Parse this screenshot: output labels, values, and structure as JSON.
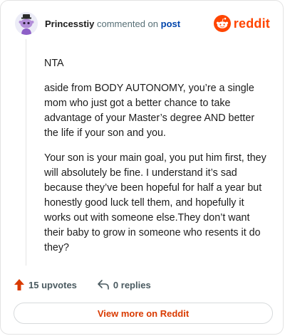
{
  "comment": {
    "username": "Princesstiy",
    "action_text": "commented on",
    "target_link": "post",
    "brand": "reddit",
    "paragraphs": [
      "NTA",
      "aside from BODY AUTONOMY, you’re a single mom who just got a better chance to take advantage of your Master’s degree AND better the life if your son and you.",
      "Your son is your main goal, you put him first, they will absolutely be fine. I understand it’s sad because they’ve been hopeful for half a year but honestly good luck tell them, and hopefully it works out with someone else.They don’t want their baby to grow in someone who resents it do they?"
    ],
    "upvotes": "15 upvotes",
    "replies": "0 replies",
    "view_more": "View more on Reddit"
  },
  "colors": {
    "brand": "#ff4500",
    "link": "#0045ac",
    "upvote": "#d93a00"
  },
  "icons": {
    "avatar": "snoo-avatar-icon",
    "logo": "reddit-logo-icon",
    "upvote": "upvote-arrow-icon",
    "reply": "reply-arrow-icon"
  }
}
